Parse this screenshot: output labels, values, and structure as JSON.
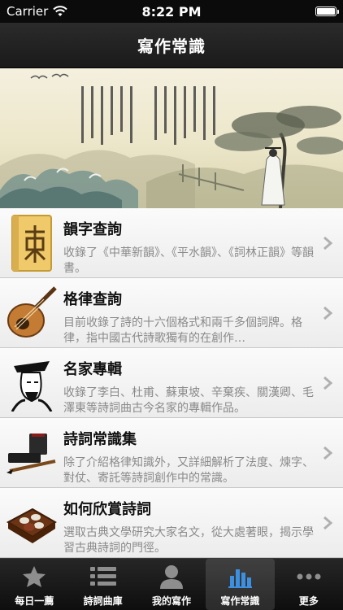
{
  "status": {
    "carrier": "Carrier",
    "time": "8:22 PM"
  },
  "nav": {
    "title": "寫作常識"
  },
  "list": {
    "items": [
      {
        "title": "韻字查詢",
        "desc": "收錄了《中華新韻》、《平水韻》、《詞林正韻》等韻書。",
        "icon": "rhyme-book-icon"
      },
      {
        "title": "格律查詢",
        "desc": "目前收錄了詩的十六個格式和兩千多個詞牌。格律，指中國古代詩歌獨有的在創作…",
        "icon": "lute-icon"
      },
      {
        "title": "名家專輯",
        "desc": "收錄了李白、杜甫、蘇東坡、辛棄疾、關漢卿、毛澤東等詩詞曲古今名家的專輯作品。",
        "icon": "poet-portrait-icon"
      },
      {
        "title": "詩詞常識集",
        "desc": "除了介紹格律知識外，又詳細解析了法度、煉字、對仗、寄託等詩詞創作中的常識。",
        "icon": "ink-brush-icon"
      },
      {
        "title": "如何欣賞詩詞",
        "desc": "選取古典文學研究大家名文，從大處著眼，揭示學習古典詩詞的門徑。",
        "icon": "tea-set-icon"
      }
    ]
  },
  "tabs": [
    {
      "label": "每日一薦",
      "icon": "star-icon"
    },
    {
      "label": "詩詞曲庫",
      "icon": "list-icon"
    },
    {
      "label": "我的寫作",
      "icon": "person-icon"
    },
    {
      "label": "寫作常識",
      "icon": "bar-chart-icon",
      "selected": true
    },
    {
      "label": "更多",
      "icon": "more-dots-icon"
    }
  ],
  "colors": {
    "tab_selected": "#3d8fe0",
    "tab_inactive": "#8e8e8e"
  }
}
